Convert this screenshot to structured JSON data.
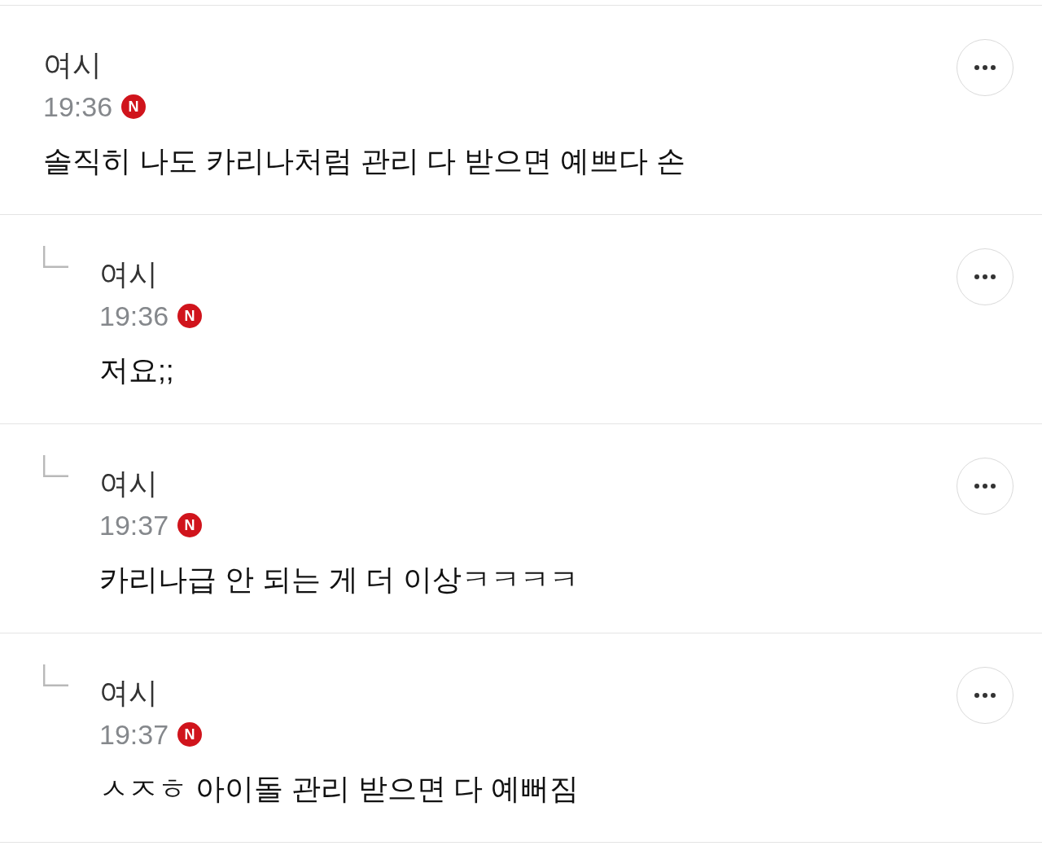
{
  "comments": [
    {
      "author": "여시",
      "time": "19:36",
      "badge": "N",
      "text": "솔직히 나도 카리나처럼 관리 다 받으면 예쁘다 손",
      "children": [
        {
          "author": "여시",
          "time": "19:36",
          "badge": "N",
          "text": "저요;;"
        },
        {
          "author": "여시",
          "time": "19:37",
          "badge": "N",
          "text": "카리나급 안 되는 게 더 이상ㅋㅋㅋㅋ"
        },
        {
          "author": "여시",
          "time": "19:37",
          "badge": "N",
          "text": "ㅅㅈㅎ 아이돌 관리 받으면 다 예뻐짐"
        }
      ]
    }
  ]
}
